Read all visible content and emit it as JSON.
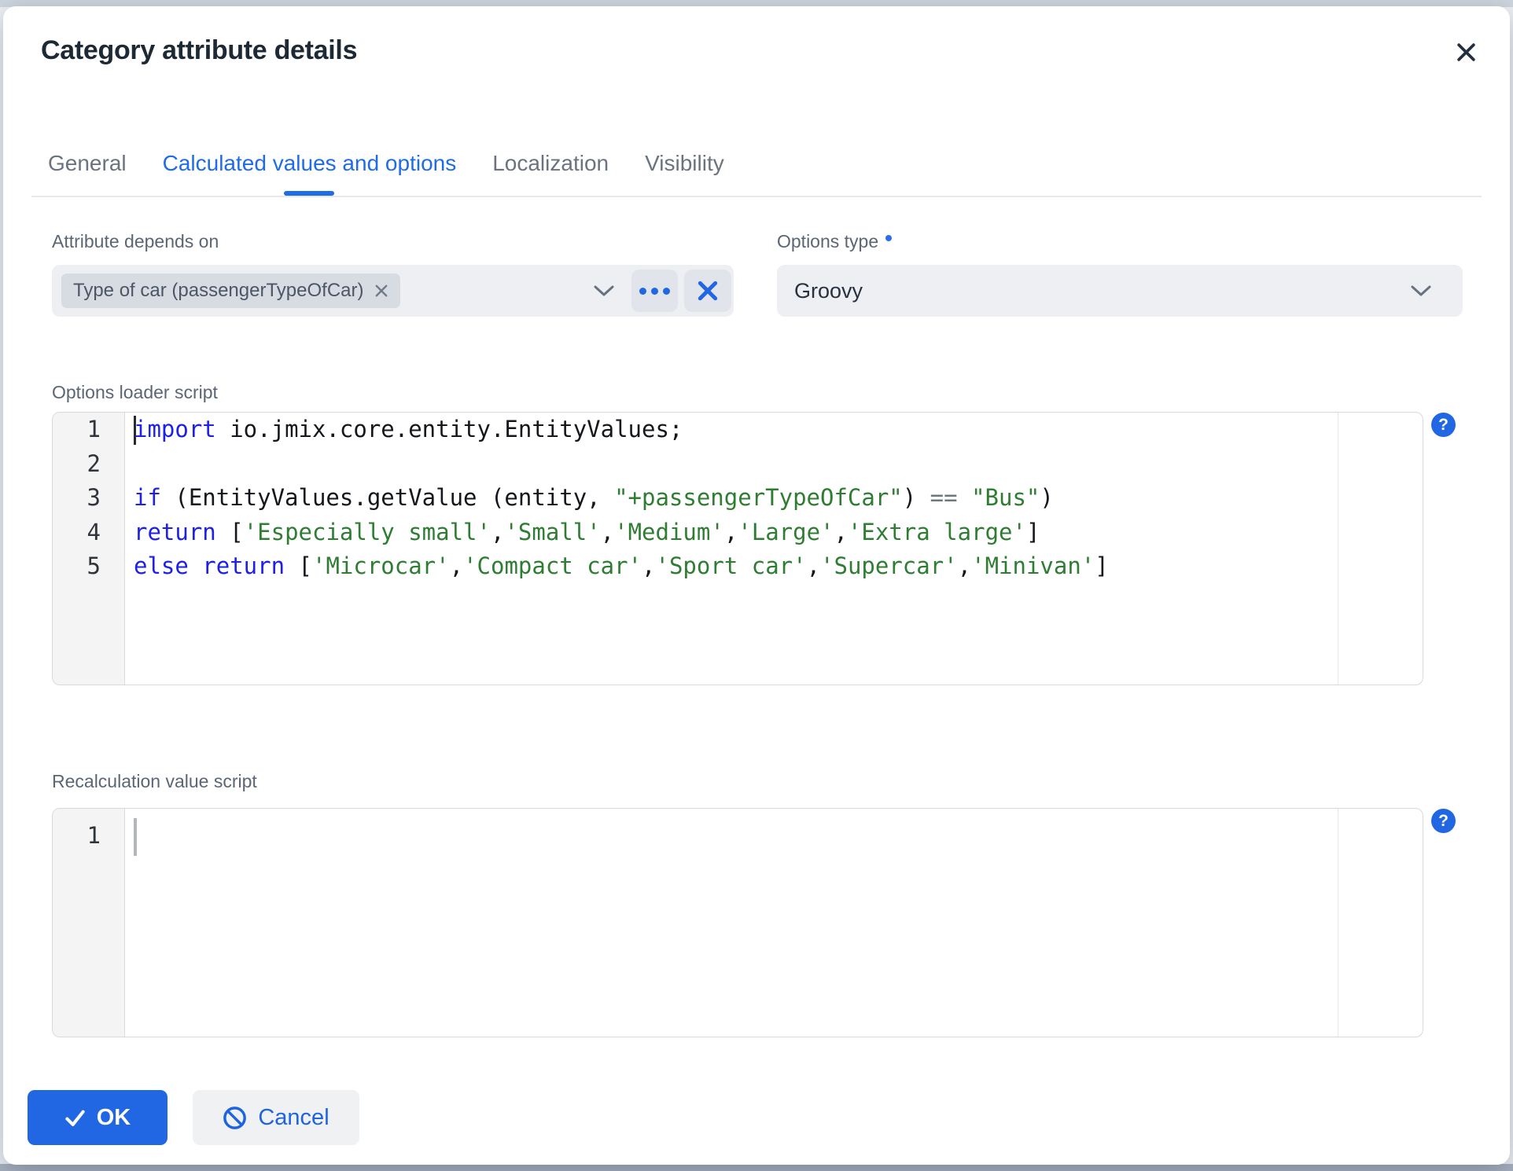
{
  "window": {
    "title": "Category attribute details"
  },
  "tabs": [
    {
      "label": "General",
      "active": false
    },
    {
      "label": "Calculated values and options",
      "active": true
    },
    {
      "label": "Localization",
      "active": false
    },
    {
      "label": "Visibility",
      "active": false
    }
  ],
  "form": {
    "attribute_depends_on": {
      "label": "Attribute depends on",
      "selected_chip": "Type of car (passengerTypeOfCar)"
    },
    "options_type": {
      "label": "Options type",
      "required": true,
      "value": "Groovy"
    },
    "options_loader": {
      "label": "Options loader script",
      "help_glyph": "?",
      "lines": [
        {
          "num": "1",
          "segments": [
            {
              "c": "k",
              "t": "import"
            },
            {
              "c": "p",
              "t": " io.jmix.core.entity.EntityValues;"
            }
          ]
        },
        {
          "num": "2",
          "segments": []
        },
        {
          "num": "3",
          "segments": [
            {
              "c": "k",
              "t": "if"
            },
            {
              "c": "p",
              "t": " (EntityValues.getValue (entity, "
            },
            {
              "c": "s",
              "t": "\"+passengerTypeOfCar\""
            },
            {
              "c": "p",
              "t": ") "
            },
            {
              "c": "o",
              "t": "=="
            },
            {
              "c": "p",
              "t": " "
            },
            {
              "c": "s",
              "t": "\"Bus\""
            },
            {
              "c": "p",
              "t": ")"
            }
          ]
        },
        {
          "num": "4",
          "segments": [
            {
              "c": "k",
              "t": "return"
            },
            {
              "c": "p",
              "t": " ["
            },
            {
              "c": "s",
              "t": "'Especially small'"
            },
            {
              "c": "p",
              "t": ","
            },
            {
              "c": "s",
              "t": "'Small'"
            },
            {
              "c": "p",
              "t": ","
            },
            {
              "c": "s",
              "t": "'Medium'"
            },
            {
              "c": "p",
              "t": ","
            },
            {
              "c": "s",
              "t": "'Large'"
            },
            {
              "c": "p",
              "t": ","
            },
            {
              "c": "s",
              "t": "'Extra large'"
            },
            {
              "c": "p",
              "t": "]"
            }
          ]
        },
        {
          "num": "5",
          "segments": [
            {
              "c": "k",
              "t": "else return"
            },
            {
              "c": "p",
              "t": " ["
            },
            {
              "c": "s",
              "t": "'Microcar'"
            },
            {
              "c": "p",
              "t": ","
            },
            {
              "c": "s",
              "t": "'Compact car'"
            },
            {
              "c": "p",
              "t": ","
            },
            {
              "c": "s",
              "t": "'Sport car'"
            },
            {
              "c": "p",
              "t": ","
            },
            {
              "c": "s",
              "t": "'Supercar'"
            },
            {
              "c": "p",
              "t": ","
            },
            {
              "c": "s",
              "t": "'Minivan'"
            },
            {
              "c": "p",
              "t": "]"
            }
          ]
        }
      ]
    },
    "recalculation": {
      "label": "Recalculation value script",
      "help_glyph": "?",
      "lines": [
        {
          "num": "1",
          "segments": []
        }
      ]
    }
  },
  "footer": {
    "ok_label": "OK",
    "cancel_label": "Cancel"
  },
  "icons": {
    "close": "x-mark",
    "chevron": "chevron-down",
    "ellipsis": "three-dots",
    "clear": "x-mark",
    "help": "question-circle",
    "ok": "checkmark",
    "cancel": "ban-circle",
    "chip_remove": "x-mark"
  },
  "colors": {
    "accent_blue": "#2166e3",
    "tab_active": "#1f6be8",
    "tab_inactive": "#6b7380",
    "field_bg": "#edeff2",
    "chip_bg": "#d7dce3",
    "code_keyword": "#1d20e8",
    "code_string": "#2e7d32",
    "code_operator": "#6e7781",
    "gutter_bg": "#f4f4f5",
    "backdrop_top": "#ced5de",
    "backdrop_bottom": "#a9b2c0"
  }
}
